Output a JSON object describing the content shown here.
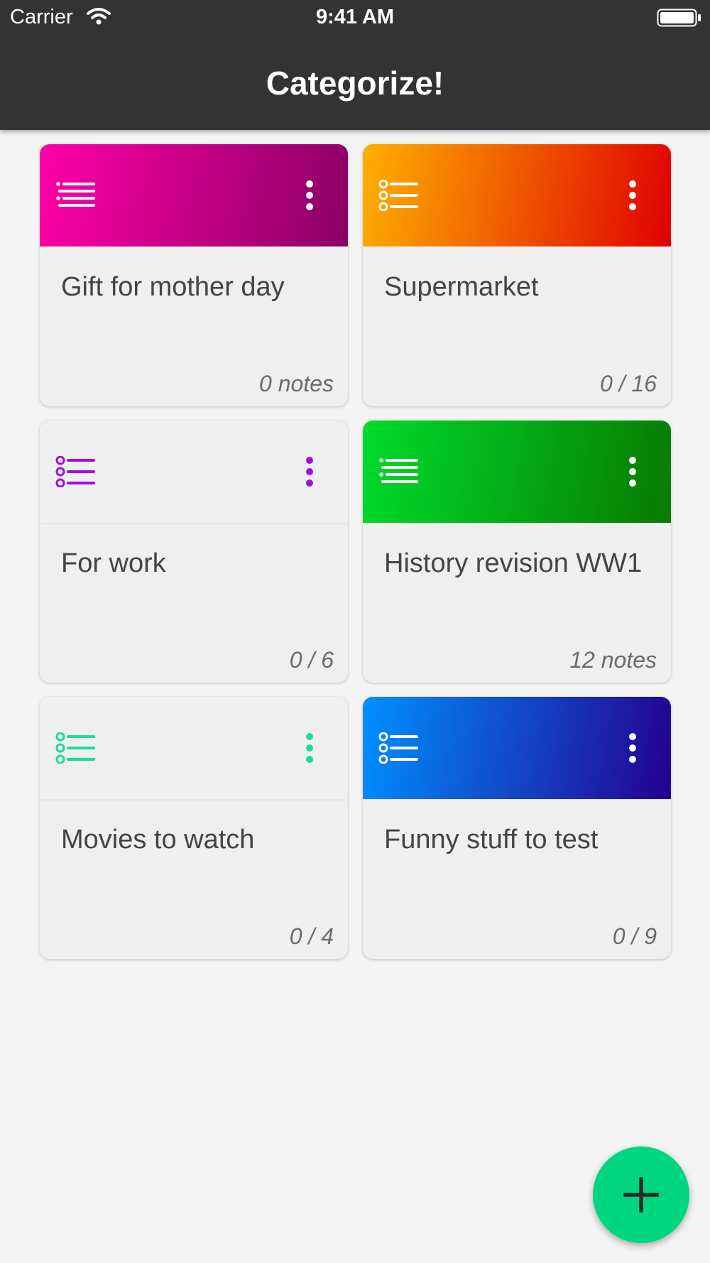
{
  "status_bar": {
    "carrier": "Carrier",
    "time": "9:41 AM"
  },
  "header": {
    "title": "Categorize!"
  },
  "categories": [
    {
      "title": "Gift for mother day",
      "count": "0 notes",
      "icon": "bullet-list-icon",
      "header_style": "gradient",
      "gradient": [
        "#ff00a8",
        "#8a0064"
      ],
      "accent": "#ffffff"
    },
    {
      "title": "Supermarket",
      "count": "0 / 16",
      "icon": "checklist-icon",
      "header_style": "gradient",
      "gradient": [
        "#ffb000",
        "#e00000"
      ],
      "accent": "#ffffff"
    },
    {
      "title": "For work",
      "count": "0 / 6",
      "icon": "checklist-icon",
      "header_style": "plain",
      "accent": "#a010e0"
    },
    {
      "title": "History revision WW1",
      "count": "12 notes",
      "icon": "bullet-list-icon",
      "header_style": "gradient",
      "gradient": [
        "#00dc2c",
        "#087a00"
      ],
      "accent": "#ffffff"
    },
    {
      "title": "Movies to watch",
      "count": "0 / 4",
      "icon": "checklist-icon",
      "header_style": "plain",
      "accent": "#19dca0"
    },
    {
      "title": "Funny stuff to test",
      "count": "0 / 9",
      "icon": "checklist-icon",
      "header_style": "gradient",
      "gradient": [
        "#0090ff",
        "#240090"
      ],
      "accent": "#ffffff"
    }
  ],
  "fab": {
    "icon": "plus-icon",
    "color": "#00d680"
  }
}
